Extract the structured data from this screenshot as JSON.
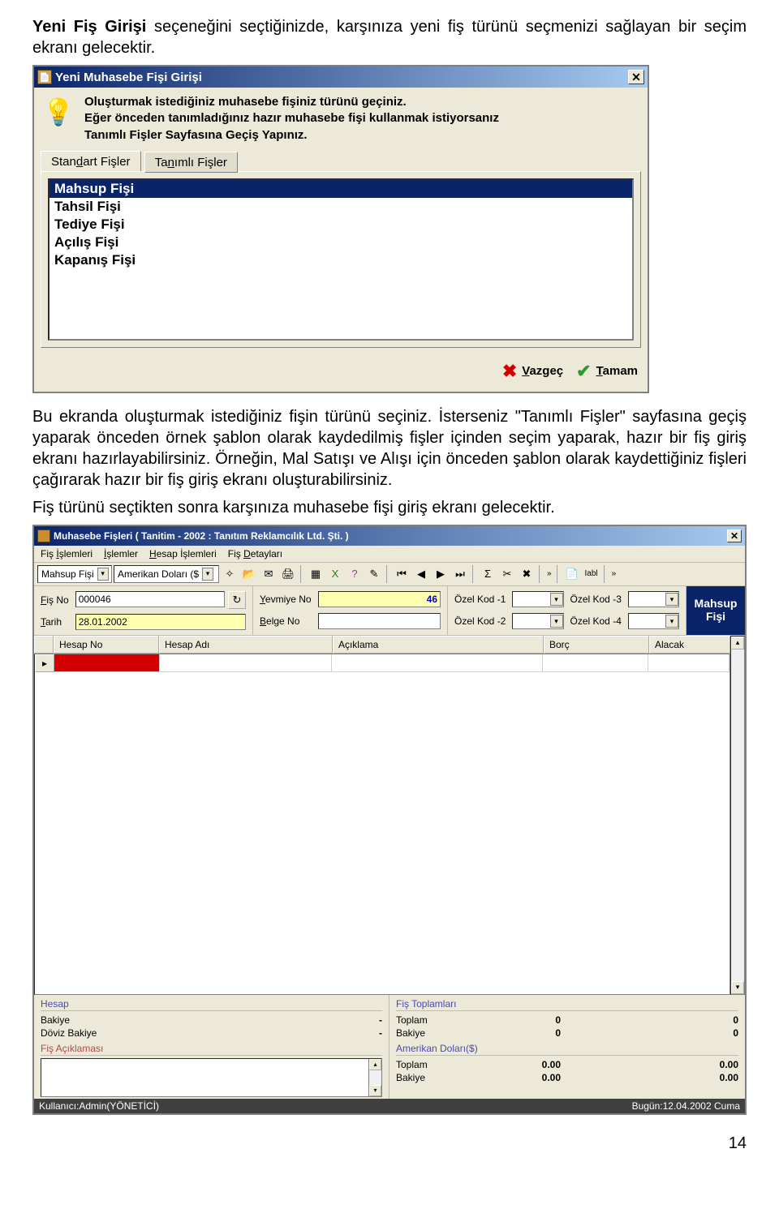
{
  "intro1_a": "Yeni Fiş Girişi",
  "intro1_b": " seçeneğini seçtiğinizde, karşınıza yeni fiş türünü seçmenizi sağlayan bir seçim ekranı gelecektir.",
  "dlg1": {
    "title": "Yeni Muhasebe Fişi Girişi",
    "desc1": "Oluşturmak istediğiniz muhasebe fişiniz türünü geçiniz.",
    "desc2": "Eğer önceden tanımladığınız hazır muhasebe fişi kullanmak istiyorsanız",
    "desc3": "Tanımlı Fişler Sayfasına Geçiş Yapınız.",
    "tab_standart": "Standart Fişler",
    "tab_tanimli": "Tanımlı Fişler",
    "tab1_d_idx": 4,
    "tab2_n_idx": 2,
    "items": [
      "Mahsup Fişi",
      "Tahsil Fişi",
      "Tediye Fişi",
      "Açılış Fişi",
      "Kapanış Fişi"
    ],
    "btn_cancel": "Vazgeç",
    "btn_ok": "Tamam",
    "cancel_u_idx": 0,
    "ok_u_idx": 0
  },
  "para2_full": "Bu ekranda oluşturmak istediğiniz fişin türünü seçiniz. İsterseniz \"Tanımlı Fişler\" sayfasına geçiş yaparak önceden örnek şablon olarak kaydedilmiş fişler içinden seçim yaparak, hazır bir fiş giriş ekranı hazırlayabilirsiniz. Örneğin, Mal Satışı ve Alışı için önceden şablon olarak kaydettiğiniz fişleri çağırarak hazır bir fiş giriş ekranı oluşturabilirsiniz.",
  "para3": "Fiş türünü seçtikten sonra karşınıza muhasebe fişi giriş ekranı gelecektir.",
  "app": {
    "title": "Muhasebe Fişleri ( Tanitim - 2002 : Tanıtım Reklamcılık Ltd. Şti. )",
    "menu": [
      {
        "t": "Fiş İşlemleri",
        "u": 4
      },
      {
        "t": "İşlemler",
        "u": 0
      },
      {
        "t": "Hesap İşlemleri",
        "u": 0
      },
      {
        "t": "Fiş Detayları",
        "u": 4
      }
    ],
    "combo_fistype": "Mahsup Fişi",
    "combo_doviz": "Amerikan Doları ($",
    "hdr": {
      "fisno_lbl": "Fiş No",
      "fisno": "000046",
      "tarih_lbl": "Tarih",
      "tarih": "28.01.2002",
      "yevno_lbl": "Yevmiye No",
      "yevno": "46",
      "belge_lbl": "Belge No",
      "belge": "",
      "oz1_lbl": "Özel Kod -1",
      "oz2_lbl": "Özel Kod -2",
      "oz3_lbl": "Özel Kod -3",
      "oz4_lbl": "Özel Kod -4"
    },
    "badge_line1": "Mahsup",
    "badge_line2": "Fişi",
    "grid_cols": [
      "",
      "Hesap No",
      "Hesap Adı",
      "Açıklama",
      "Borç",
      "Alacak"
    ],
    "hesap_title": "Hesap",
    "hesap": [
      {
        "k": "Bakiye",
        "v": "-"
      },
      {
        "k": "Döviz Bakiye",
        "v": "-"
      }
    ],
    "fistoplam_title": "Fiş Toplamları",
    "fistoplam": [
      {
        "k": "Toplam",
        "v": "0",
        "v2": "0"
      },
      {
        "k": "Bakiye",
        "v": "0",
        "v2": "0"
      }
    ],
    "doviz_title": "Amerikan Doları($)",
    "doviz_rows": [
      {
        "k": "Toplam",
        "v": "0.00",
        "v2": "0.00"
      },
      {
        "k": "Bakiye",
        "v": "0.00",
        "v2": "0.00"
      }
    ],
    "acik_title": "Fiş Açıklaması",
    "status_user": "Kullanıcı:Admin(YÖNETİCİ)",
    "status_date": "Bugün:12.04.2002 Cuma"
  },
  "page_no": "14"
}
